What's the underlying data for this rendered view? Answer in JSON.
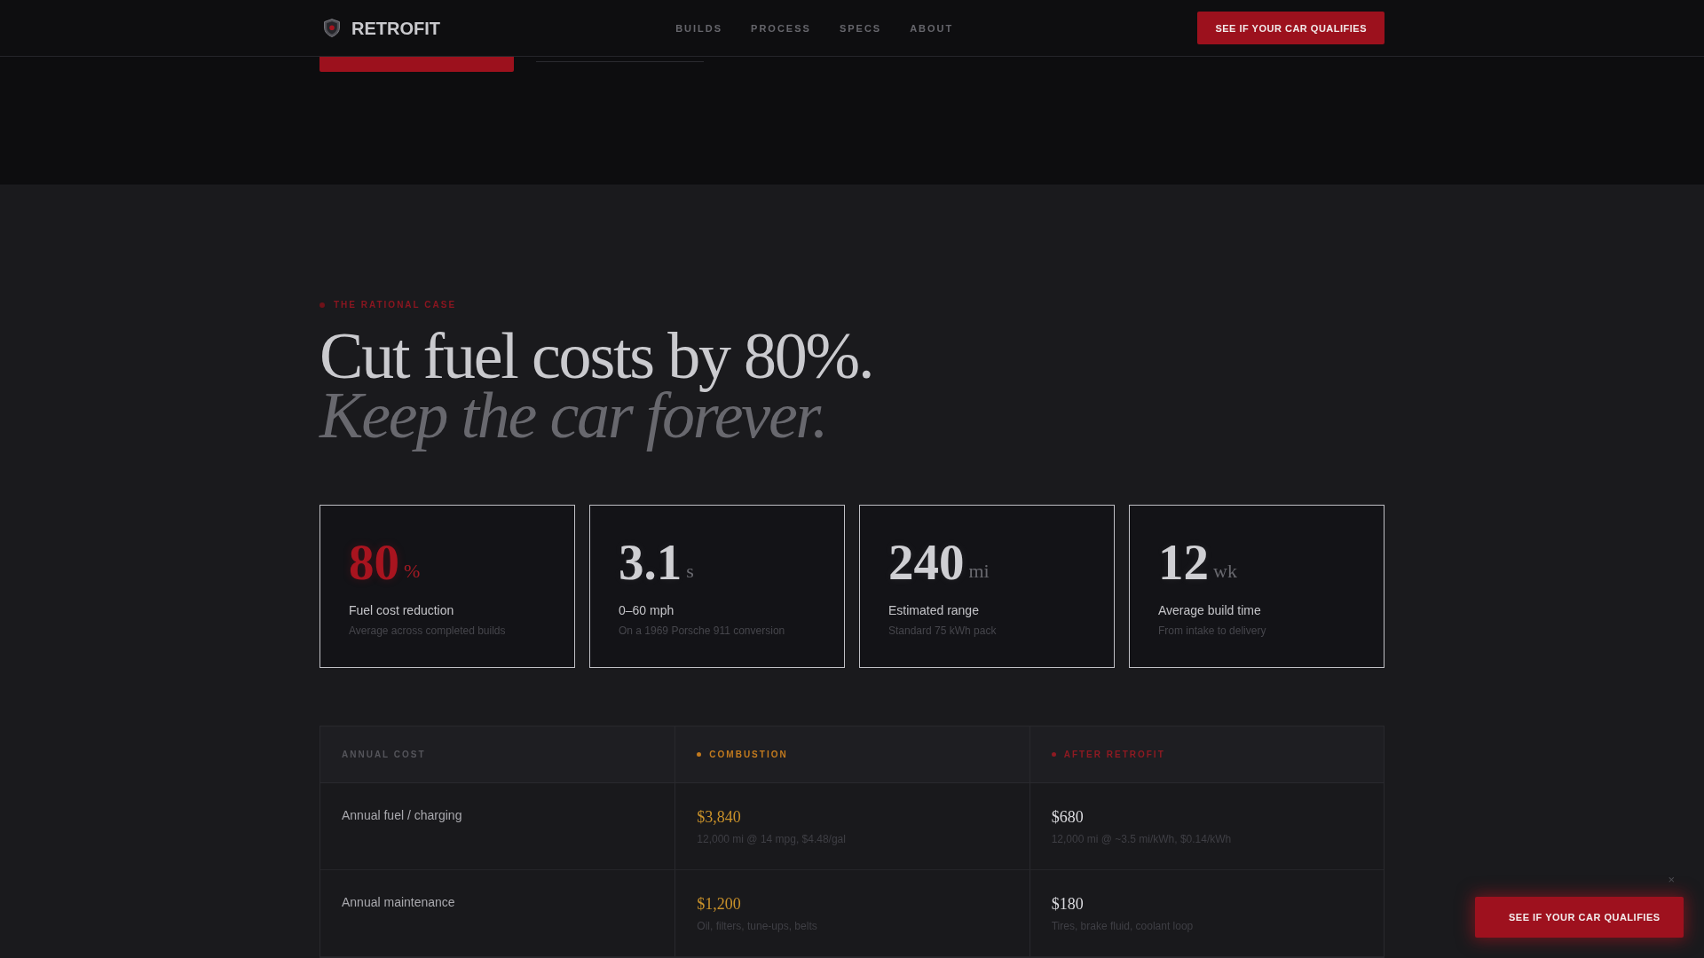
{
  "header": {
    "brand": "RETROFIT",
    "nav": [
      "BUILDS",
      "PROCESS",
      "SPECS",
      "ABOUT"
    ],
    "cta": "SEE IF YOUR CAR QUALIFIES"
  },
  "section": {
    "eyebrow": "THE RATIONAL CASE",
    "headline": "Cut fuel costs by 80%.",
    "subheadline": "Keep the car forever.",
    "stats": [
      {
        "value": "80",
        "unit": "%",
        "label": "Fuel cost reduction",
        "note": "Average across completed builds",
        "highlighted": true
      },
      {
        "value": "3.1",
        "unit": "s",
        "label": "0–60 mph",
        "note": "On a 1969 Porsche 911 conversion",
        "highlighted": false
      },
      {
        "value": "240",
        "unit": "mi",
        "label": "Estimated range",
        "note": "Standard 75 kWh pack",
        "highlighted": false
      },
      {
        "value": "12",
        "unit": "wk",
        "label": "Average build time",
        "note": "From intake to delivery",
        "highlighted": false
      }
    ],
    "table": {
      "columns": [
        {
          "label": "ANNUAL COST",
          "kind": "label"
        },
        {
          "label": "COMBUSTION",
          "kind": "before",
          "color": "#c27a1e"
        },
        {
          "label": "AFTER RETROFIT",
          "kind": "after",
          "color": "#8e1a22"
        }
      ],
      "rows": [
        {
          "cells": [
            {
              "text": "Annual fuel / charging"
            },
            {
              "value": "$3,840",
              "note": "12,000 mi @ 14 mpg, $4.48/gal"
            },
            {
              "value": "$680",
              "note": "12,000 mi @ ~3.5 mi/kWh, $0.14/kWh"
            }
          ]
        },
        {
          "cells": [
            {
              "text": "Annual maintenance"
            },
            {
              "value": "$1,200",
              "note": "Oil, filters, tune-ups, belts"
            },
            {
              "value": "$180",
              "note": "Tires, brake fluid, coolant loop"
            }
          ]
        }
      ]
    }
  },
  "floating_cta": {
    "label": "SEE IF YOUR CAR QUALIFIES",
    "close": "×"
  }
}
